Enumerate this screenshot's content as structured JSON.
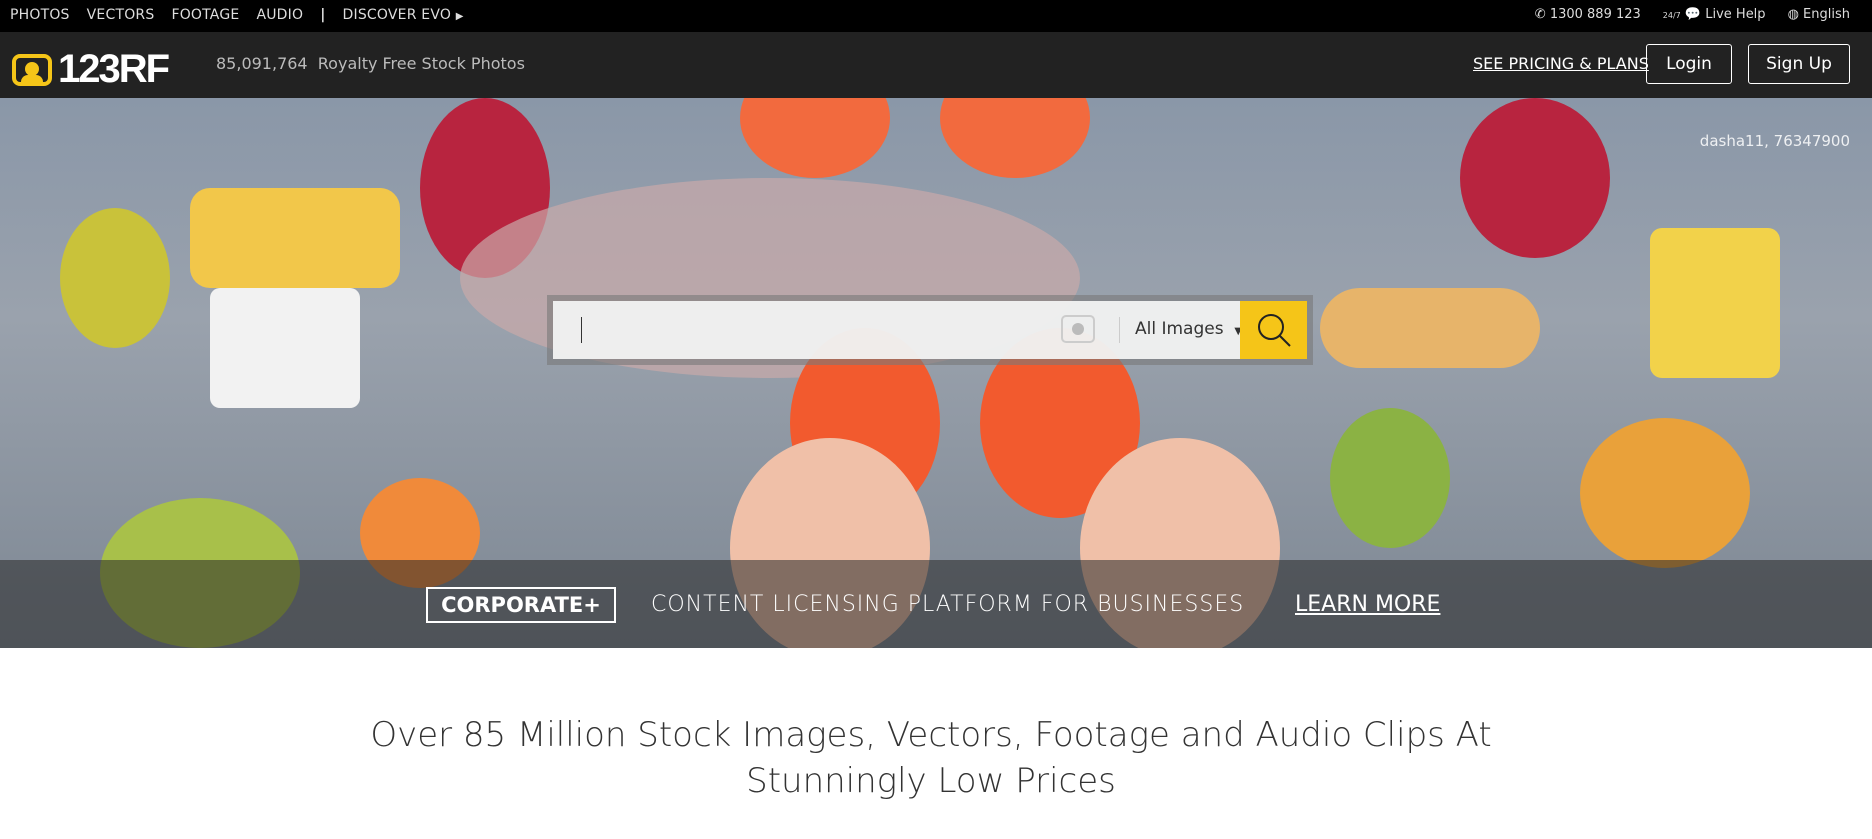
{
  "topbar": {
    "nav": [
      "PHOTOS",
      "VECTORS",
      "FOOTAGE",
      "AUDIO"
    ],
    "divider": "|",
    "discover": "DISCOVER EVO",
    "phone": "1300 889 123",
    "help_badge": "24/7",
    "live_help": "Live Help",
    "language": "English"
  },
  "header": {
    "logo": "123RF",
    "count": "85,091,764",
    "count_label": "Royalty Free Stock Photos",
    "pricing": "SEE PRICING & PLANS",
    "login": "Login",
    "signup": "Sign Up"
  },
  "hero": {
    "watermark": "dasha11, 76347900",
    "search": {
      "value": "",
      "filter": "All Images"
    }
  },
  "corporate": {
    "badge": "CORPORATE+",
    "text": "CONTENT LICENSING PLATFORM FOR BUSINESSES",
    "link": "LEARN MORE"
  },
  "headline": "Over 85 Million Stock Images, Vectors, Footage and Audio Clips At Stunningly Low Prices",
  "colors": {
    "accent": "#f5c518",
    "header_bg": "#222222",
    "topbar_bg": "#000000"
  }
}
